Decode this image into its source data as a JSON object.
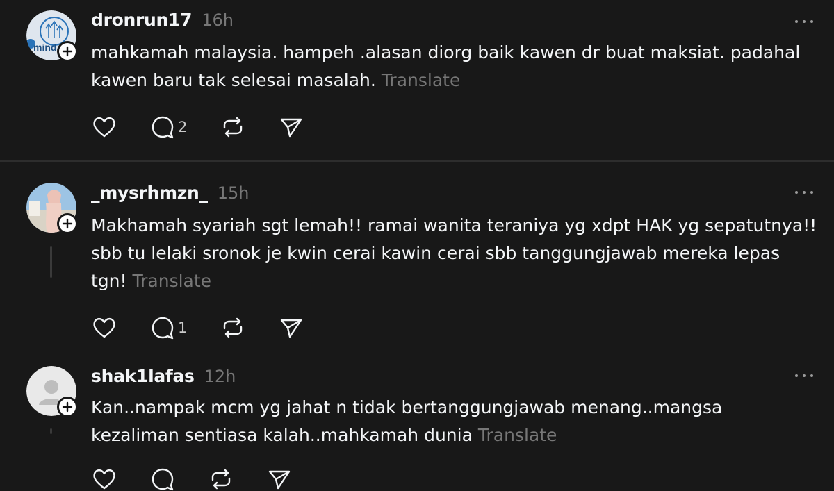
{
  "posts": [
    {
      "username": "dronrun17",
      "time": "16h",
      "text_lines": [
        "mahkamah malaysia. hampeh .alasan diorg baik kawen dr buat maksiat. padahal",
        "kawen baru tak selesai masalah."
      ],
      "translate_label": "Translate",
      "reply_count": "2",
      "avatar_text": "mind"
    },
    {
      "username": "_mysrhmzn_",
      "time": "15h",
      "text_lines": [
        "Makhamah syariah sgt lemah!! ramai wanita teraniya yg xdpt HAK yg sepatutnya!!",
        "sbb tu lelaki sronok je kwin cerai kawin cerai sbb tanggungjawab mereka lepas",
        "tgn!"
      ],
      "translate_label": "Translate",
      "reply_count": "1"
    },
    {
      "username": "shak1lafas",
      "time": "12h",
      "text_lines": [
        "Kan..nampak mcm yg jahat n tidak bertanggungjawab menang..mangsa",
        "kezaliman sentiasa kalah..mahkamah dunia"
      ],
      "translate_label": "Translate"
    }
  ],
  "colors": {
    "background": "#181818",
    "text": "#f3f5f7",
    "muted": "#777777",
    "divider": "#2d2d2d"
  },
  "icons": [
    "heart-icon",
    "comment-icon",
    "repost-icon",
    "share-icon",
    "more-icon",
    "follow-plus-icon"
  ]
}
